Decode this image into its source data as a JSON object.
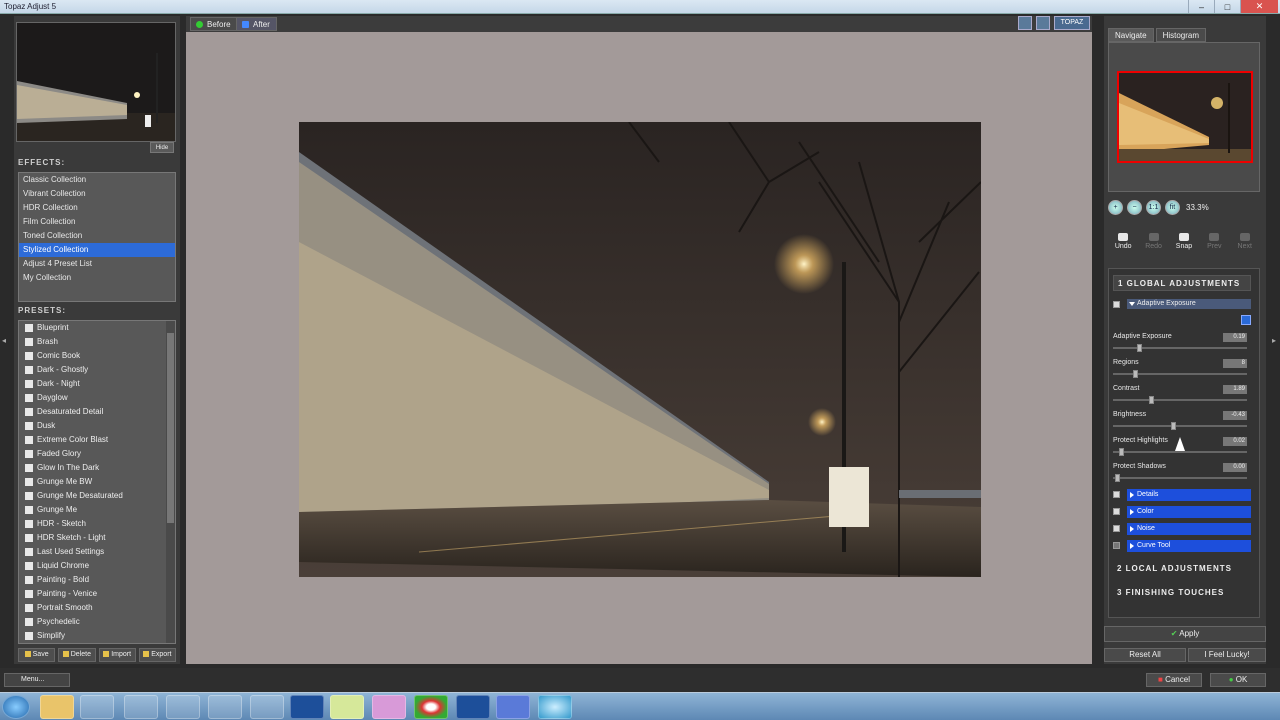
{
  "window": {
    "title": "Topaz Adjust 5",
    "controls": [
      "–",
      "□",
      "✕"
    ]
  },
  "left": {
    "hide_label": "Hide",
    "effects_header": "EFFECTS:",
    "effects": [
      "Classic Collection",
      "Vibrant Collection",
      "HDR Collection",
      "Film Collection",
      "Toned Collection",
      "Stylized Collection",
      "Adjust 4 Preset List",
      "My Collection"
    ],
    "selected_effect_index": 5,
    "presets_header": "PRESETS:",
    "presets": [
      "Blueprint",
      "Brash",
      "Comic Book",
      "Dark - Ghostly",
      "Dark - Night",
      "Dayglow",
      "Desaturated Detail",
      "Dusk",
      "Extreme Color Blast",
      "Faded Glory",
      "Glow In The Dark",
      "Grunge Me BW",
      "Grunge Me Desaturated",
      "Grunge Me",
      "HDR - Sketch",
      "HDR Sketch - Light",
      "Last Used Settings",
      "Liquid Chrome",
      "Painting - Bold",
      "Painting - Venice",
      "Portrait Smooth",
      "Psychedelic",
      "Simplify"
    ],
    "preset_buttons": [
      "Save",
      "Delete",
      "Import",
      "Export"
    ]
  },
  "center": {
    "tab_before": "Before",
    "tab_after": "After",
    "brand": "TOPAZ"
  },
  "right": {
    "tab_navigate": "Navigate",
    "tab_histogram": "Histogram",
    "zoom_icons": [
      "+",
      "−",
      "1:1",
      "fit"
    ],
    "zoom_level": "33.3%",
    "history": [
      {
        "label": "Undo",
        "enabled": true
      },
      {
        "label": "Redo",
        "enabled": false
      },
      {
        "label": "Snap",
        "enabled": true
      },
      {
        "label": "Prev",
        "enabled": false
      },
      {
        "label": "Next",
        "enabled": false
      }
    ],
    "section1": "1 GLOBAL ADJUSTMENTS",
    "subsection": "Adaptive Exposure",
    "sliders": [
      {
        "label": "Adaptive Exposure",
        "value": "0.19",
        "position": 0.19
      },
      {
        "label": "Regions",
        "value": "8",
        "position": 0.15
      },
      {
        "label": "Contrast",
        "value": "1.89",
        "position": 0.38
      },
      {
        "label": "Brightness",
        "value": "-0.43",
        "position": 0.44
      },
      {
        "label": "Protect Highlights",
        "value": "0.02",
        "position": 0.02
      },
      {
        "label": "Protect Shadows",
        "value": "0.00",
        "position": 0.0
      }
    ],
    "subsections": [
      {
        "label": "Details",
        "checked": true
      },
      {
        "label": "Color",
        "checked": true
      },
      {
        "label": "Noise",
        "checked": true
      },
      {
        "label": "Curve Tool",
        "checked": false
      }
    ],
    "section2": "2 LOCAL ADJUSTMENTS",
    "section3": "3 FINISHING TOUCHES",
    "apply": "Apply",
    "reset_all": "Reset All",
    "feel_lucky": "I Feel Lucky!"
  },
  "status": {
    "menu": "Menu...",
    "cancel": "Cancel",
    "ok": "OK"
  },
  "taskbar": {
    "apps": [
      "start",
      "explorer",
      "media",
      "chrome-ish",
      "mail",
      "app5",
      "tools",
      "photoshop",
      "notes",
      "paint",
      "chrome",
      "photoshop2",
      "topaz",
      "globe"
    ],
    "tray_time": "",
    "tray_date": ""
  }
}
